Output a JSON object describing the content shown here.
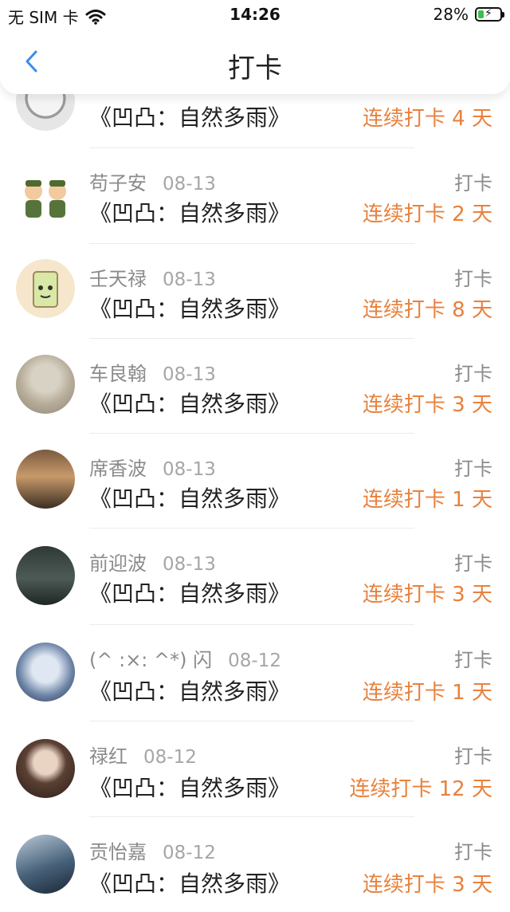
{
  "status_bar": {
    "carrier": "无 SIM 卡",
    "time": "14:26",
    "battery": "28%",
    "battery_level": 0.28,
    "wifi_icon": "wifi-icon",
    "battery_icon": "battery-charging-icon"
  },
  "nav": {
    "title": "打卡",
    "back_icon": "chevron-left-icon"
  },
  "colors": {
    "accent": "#e8813d",
    "back": "#3a8ee6"
  },
  "entries": [
    {
      "name": "",
      "date": "",
      "book": "《凹凸：自然多雨》",
      "action": "",
      "streak": "连续打卡 4 天"
    },
    {
      "name": "苟子安",
      "date": "08-13",
      "book": "《凹凸：自然多雨》",
      "action": "打卡",
      "streak": "连续打卡 2 天"
    },
    {
      "name": "壬天禄",
      "date": "08-13",
      "book": "《凹凸：自然多雨》",
      "action": "打卡",
      "streak": "连续打卡 8 天"
    },
    {
      "name": "车良翰",
      "date": "08-13",
      "book": "《凹凸：自然多雨》",
      "action": "打卡",
      "streak": "连续打卡 3 天"
    },
    {
      "name": "席香波",
      "date": "08-13",
      "book": "《凹凸：自然多雨》",
      "action": "打卡",
      "streak": "连续打卡 1 天"
    },
    {
      "name": "前迎波",
      "date": "08-13",
      "book": "《凹凸：自然多雨》",
      "action": "打卡",
      "streak": "连续打卡 3 天"
    },
    {
      "name": "(^ :×: ^*) 闪",
      "date": "08-12",
      "book": "《凹凸：自然多雨》",
      "action": "打卡",
      "streak": "连续打卡 1 天"
    },
    {
      "name": "禄红",
      "date": "08-12",
      "book": "《凹凸：自然多雨》",
      "action": "打卡",
      "streak": "连续打卡 12 天"
    },
    {
      "name": "贡怡嘉",
      "date": "08-12",
      "book": "《凹凸：自然多雨》",
      "action": "打卡",
      "streak": "连续打卡 3 天"
    }
  ]
}
